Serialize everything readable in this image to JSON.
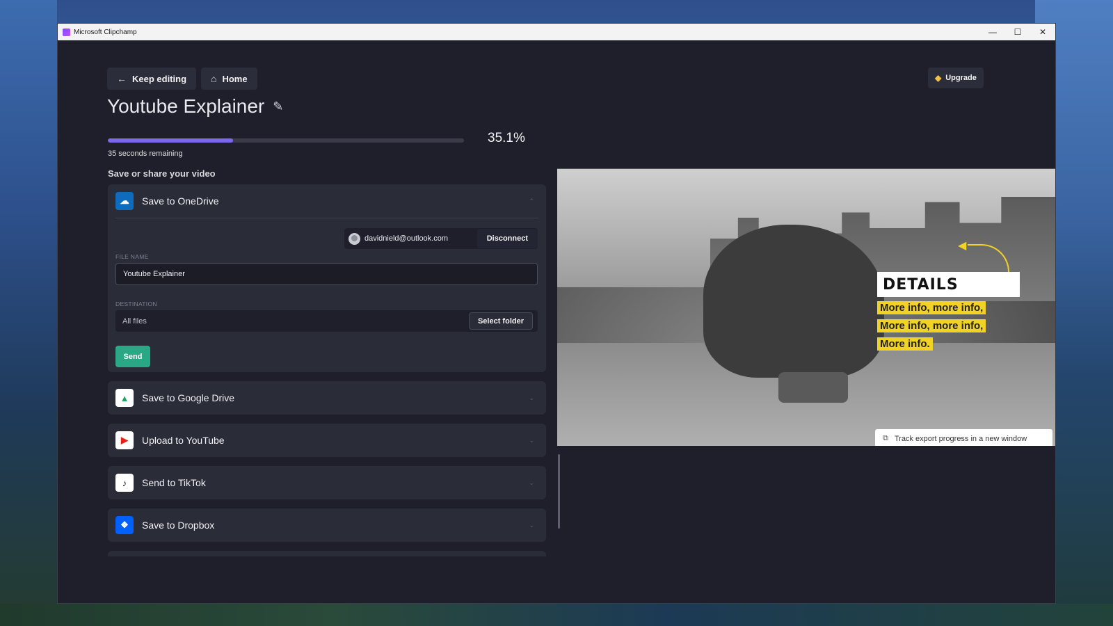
{
  "window": {
    "title": "Microsoft Clipchamp",
    "controls": {
      "minimize": "—",
      "maximize": "☐",
      "close": "✕"
    }
  },
  "nav": {
    "keep_editing": "Keep editing",
    "home": "Home",
    "upgrade": "Upgrade"
  },
  "project": {
    "title": "Youtube Explainer"
  },
  "export": {
    "progress_percent": 35.1,
    "percent_label": "35.1%",
    "remaining": "35 seconds remaining",
    "section_heading": "Save or share your video"
  },
  "onedrive": {
    "label": "Save to OneDrive",
    "account_email": "davidnield@outlook.com",
    "disconnect": "Disconnect",
    "file_name_label": "FILE NAME",
    "file_name_value": "Youtube Explainer",
    "destination_label": "DESTINATION",
    "destination_value": "All files",
    "select_folder": "Select folder",
    "send": "Send"
  },
  "services": [
    {
      "label": "Save to Google Drive",
      "icon": "google-drive-icon",
      "color": "#ffffff"
    },
    {
      "label": "Upload to YouTube",
      "icon": "youtube-icon",
      "color": "#ffffff"
    },
    {
      "label": "Send to TikTok",
      "icon": "tiktok-icon",
      "color": "#ffffff"
    },
    {
      "label": "Save to Dropbox",
      "icon": "dropbox-icon",
      "color": "#0061fe"
    }
  ],
  "preview": {
    "details": "DETAILS",
    "info_lines": [
      "More info, more info,",
      "More info, more info,",
      "More info."
    ],
    "track_button": "Track export progress in a new window"
  },
  "colors": {
    "accent": "#7b68ee",
    "send": "#2aa885",
    "highlight": "#f2d325"
  }
}
